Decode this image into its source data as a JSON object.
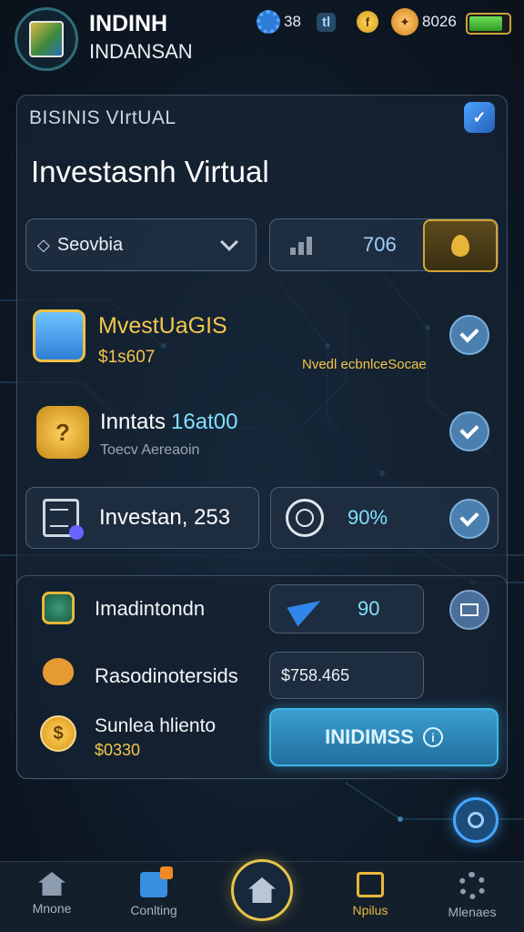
{
  "header": {
    "app_title": "INDINH",
    "app_subtitle": "INDANSAN",
    "stats": {
      "gear_value": "38",
      "chip_label": "tl",
      "coin_symbol": "f",
      "gems_value": "8026",
      "battery_level": 0.85
    }
  },
  "panel": {
    "label": "BISINIS VIrtUAL",
    "headline": "Investasnh Virtual",
    "filter": {
      "selected": "Seovbia"
    },
    "value_display": {
      "value": "706"
    }
  },
  "items": [
    {
      "title": "MvestUaGIS",
      "subtitle": "$1s607",
      "note": "Nvedl ecbnlceSocae"
    },
    {
      "title": "Inntats",
      "value": "16at00",
      "subtitle": "Toecv Aereaoin"
    },
    {
      "title": "Investan, 253",
      "percent": "90%"
    }
  ],
  "list": [
    {
      "title": "Imadintondn",
      "value": "90"
    },
    {
      "title": "Rasodinotersids",
      "value": "$758.465"
    },
    {
      "title": "Sunlea hliento",
      "subtitle": "$0330",
      "coin_symbol": "$"
    }
  ],
  "cta": {
    "label": "INIDIMSS",
    "icon_label": "i"
  },
  "nav": {
    "items": [
      {
        "label": "Mnone"
      },
      {
        "label": "Conlting"
      },
      {
        "label": "Npilus"
      },
      {
        "label": "Mlenaes"
      }
    ]
  },
  "colors": {
    "accent": "#46a6ff",
    "gold": "#e6c34a",
    "panel_bg": "#162434",
    "cyan": "#7fe0ff"
  },
  "icons": {
    "logo": "app-logo-icon",
    "gear": "gear-icon",
    "coin": "coin-icon",
    "battery": "battery-icon",
    "chest": "chest-icon",
    "shield": "shield-icon",
    "check": "check-icon",
    "mail": "mail-icon",
    "plane": "paper-plane-icon"
  }
}
